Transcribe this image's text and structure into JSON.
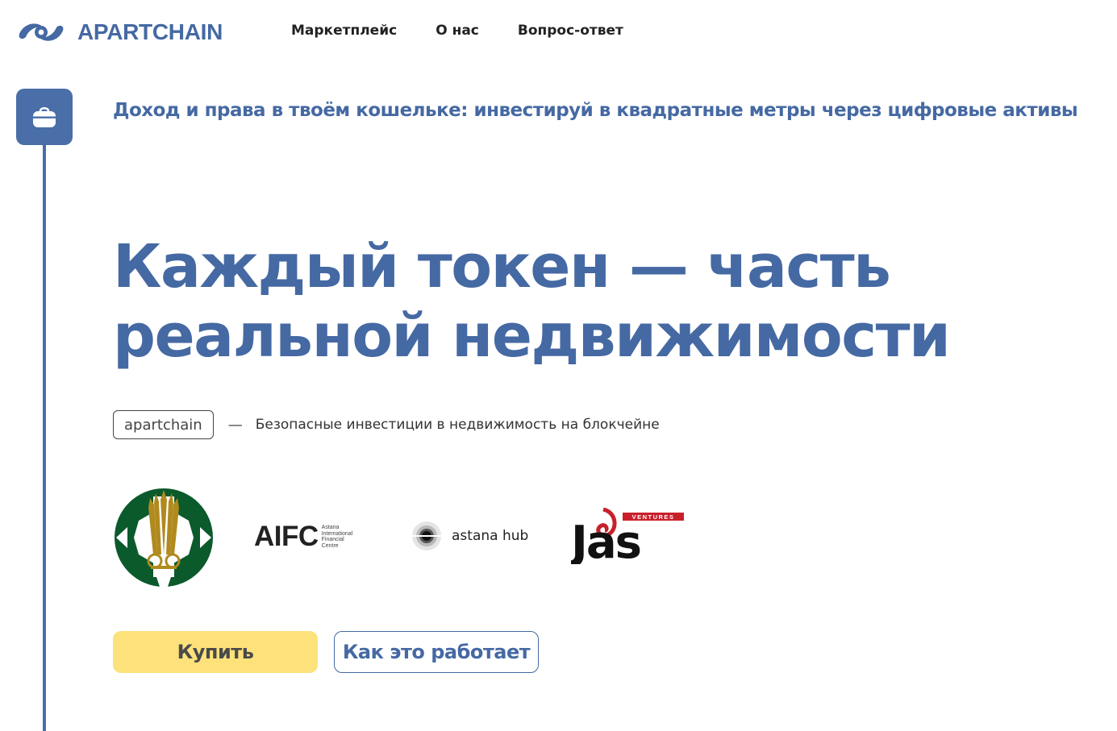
{
  "header": {
    "logo_text": "APARTCHAIN",
    "nav": [
      {
        "label": "Маркетплейс"
      },
      {
        "label": "О нас"
      },
      {
        "label": "Вопрос-ответ"
      }
    ]
  },
  "rail": {
    "icon": "wallet-icon"
  },
  "tagline": "Доход и права в твоём кошельке: инвестируй в квадратные метры через цифровые активы",
  "hero": {
    "title_line1": "Каждый токен — часть",
    "title_line2": "реальной недвижимости"
  },
  "subheading": {
    "pill": "apartchain",
    "dash": "—",
    "text": "Безопасные инвестиции в недвижимость на блокчейне"
  },
  "partners": {
    "aifc_main": "AIFC",
    "aifc_small": [
      "Astana",
      "International",
      "Financial",
      "Centre"
    ],
    "hub_text": "astana hub",
    "jas_badge": "VENTURES",
    "jas_text": "Jas"
  },
  "buttons": {
    "buy": "Купить",
    "how": "Как это работает"
  },
  "colors": {
    "brand_blue": "#4569a3",
    "rail_blue": "#4a6ea7",
    "buy_yellow": "#fde17a",
    "kz_green": "#0b5a2c",
    "kz_gold": "#b08a1e",
    "jas_red": "#c8202b"
  }
}
